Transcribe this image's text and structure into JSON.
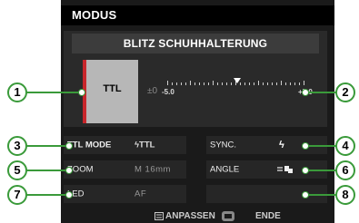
{
  "header": {
    "title": "MODUS"
  },
  "panel": {
    "title": "BLITZ SCHUHHALTERUNG",
    "mode_value": "TTL",
    "compensation": "±0",
    "scale_min": "-5.0",
    "scale_max": "+5.0"
  },
  "settings": {
    "ttl_mode_label": "TTL MODE",
    "ttl_mode_value": "ϟTTL",
    "sync_label": "SYNC.",
    "zoom_label": "ZOOM",
    "zoom_value": "M 16mm",
    "angle_label": "ANGLE",
    "led_label": "LED",
    "led_value": "AF"
  },
  "footer": {
    "adjust_label": "ANPASSEN",
    "end_label": "ENDE"
  },
  "callouts": [
    "1",
    "2",
    "3",
    "4",
    "5",
    "6",
    "7",
    "8"
  ]
}
